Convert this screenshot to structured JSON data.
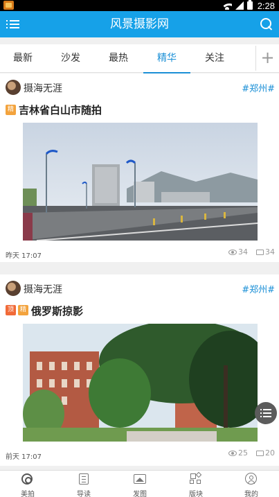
{
  "status_bar": {
    "time": "2:28"
  },
  "app_bar": {
    "title": "风景摄影网"
  },
  "tabs": [
    {
      "label": "最新",
      "active": false
    },
    {
      "label": "沙发",
      "active": false
    },
    {
      "label": "最热",
      "active": false
    },
    {
      "label": "精华",
      "active": true
    },
    {
      "label": "关注",
      "active": false
    }
  ],
  "add_tab_label": "+",
  "posts": [
    {
      "author": "摄海无涯",
      "tag": "#郑州#",
      "badges": [
        "精"
      ],
      "title": "吉林省白山市随拍",
      "time": "昨天 17:07",
      "views": "34",
      "comments": "34"
    },
    {
      "author": "摄海无涯",
      "tag": "#郑州#",
      "badges": [
        "顶",
        "精"
      ],
      "title": "俄罗斯掠影",
      "time": "前天 17:07",
      "views": "25",
      "comments": "20"
    }
  ],
  "bottom_nav": [
    {
      "label": "美拍",
      "icon": "camera-aperture-icon"
    },
    {
      "label": "导读",
      "icon": "list-icon"
    },
    {
      "label": "发图",
      "icon": "image-icon"
    },
    {
      "label": "版块",
      "icon": "grid-icon"
    },
    {
      "label": "我的",
      "icon": "user-icon"
    }
  ],
  "colors": {
    "accent": "#16a1e8",
    "tab_active": "#1a8fd6",
    "badge_jing": "#f3a33d",
    "badge_ding": "#f16a38"
  }
}
